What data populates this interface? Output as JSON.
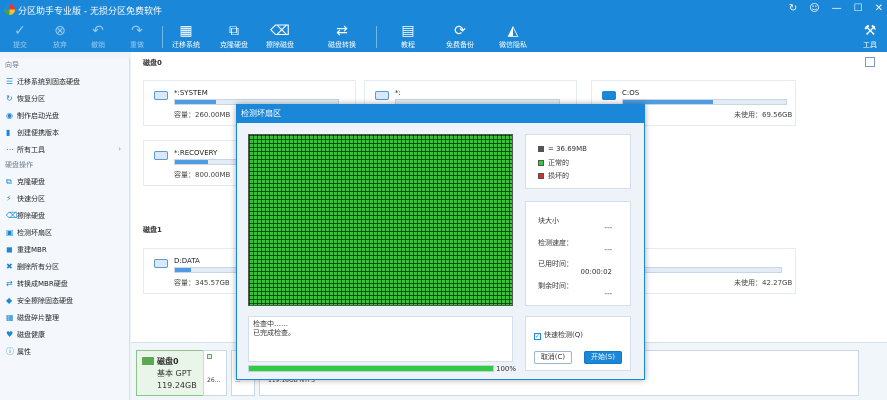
{
  "app": {
    "title": "分区助手专业版 - 无损分区免费软件",
    "window_buttons": [
      "↻",
      "☺",
      "—",
      "☐",
      "✕"
    ]
  },
  "toolbar": {
    "left": [
      {
        "label": "提交",
        "icon": "check-icon",
        "glyph": "✓"
      },
      {
        "label": "放弃",
        "icon": "cancel-icon",
        "glyph": "⊗"
      },
      {
        "label": "撤销",
        "icon": "undo-icon",
        "glyph": "↶"
      },
      {
        "label": "重做",
        "icon": "redo-icon",
        "glyph": "↷"
      }
    ],
    "middle": [
      {
        "label": "迁移系统",
        "icon": "migrate-os-icon",
        "glyph": "▦"
      },
      {
        "label": "克隆硬盘",
        "icon": "clone-disk-icon",
        "glyph": "⧉"
      },
      {
        "label": "擦除磁盘",
        "icon": "wipe-disk-icon",
        "glyph": "⌫"
      },
      {
        "label": "磁盘转换",
        "icon": "convert-disk-icon",
        "glyph": "⇄"
      },
      {
        "label": "教程",
        "icon": "tutorial-icon",
        "glyph": "▤"
      },
      {
        "label": "免费备份",
        "icon": "backup-icon",
        "glyph": "⟳"
      },
      {
        "label": "微信隐私",
        "icon": "wechat-privacy-icon",
        "glyph": "◭"
      }
    ],
    "right": {
      "label": "工具",
      "icon": "tools-icon",
      "glyph": "⚒"
    }
  },
  "sidebar": {
    "wizard_heading": "向导",
    "wizard_items": [
      {
        "label": "迁移系统到固态硬盘",
        "icon": "☰"
      },
      {
        "label": "恢复分区",
        "icon": "↻"
      },
      {
        "label": "制作启动光盘",
        "icon": "◉"
      },
      {
        "label": "创建便携版本",
        "icon": "▮"
      },
      {
        "label": "所有工具",
        "icon": "⋯"
      }
    ],
    "disk_heading": "硬盘操作",
    "disk_items": [
      {
        "label": "克隆硬盘",
        "icon": "⧉"
      },
      {
        "label": "快速分区",
        "icon": "⚡"
      },
      {
        "label": "擦除硬盘",
        "icon": "⌫"
      },
      {
        "label": "检测坏扇区",
        "icon": "▣"
      },
      {
        "label": "重建MBR",
        "icon": "◼"
      },
      {
        "label": "删除所有分区",
        "icon": "✖"
      },
      {
        "label": "转换成MBR硬盘",
        "icon": "⇄"
      },
      {
        "label": "安全擦除固态硬盘",
        "icon": "◆"
      },
      {
        "label": "磁盘碎片整理",
        "icon": "▦"
      },
      {
        "label": "磁盘健康",
        "icon": "♥"
      },
      {
        "label": "属性",
        "icon": "ⓘ"
      }
    ]
  },
  "main": {
    "disk0_label": "磁盘0",
    "disk1_label": "磁盘1",
    "capacity_label": "容量：",
    "free_label": "未使用：",
    "partitions": [
      {
        "name": "*:SYSTEM",
        "capacity": "260.00MB",
        "free": "",
        "fill": 0.25
      },
      {
        "name": "*:",
        "capacity": "",
        "free": "",
        "fill": 0.0
      },
      {
        "name": "C:OS",
        "capacity": "",
        "free": "69.56GB",
        "fill": 0.55
      },
      {
        "name": "*:RECOVERY",
        "capacity": "800.00MB",
        "free": "",
        "fill": 0.2
      },
      {
        "name": "D:DATA",
        "capacity": "345.57GB",
        "free": "42.27GB",
        "fill": 0.1
      }
    ],
    "partial_free": [
      "GB",
      "GB"
    ]
  },
  "diskmap": {
    "disk_name": "磁盘0",
    "disk_type": "基本 GPT",
    "disk_size": "119.24GB",
    "cells": [
      {
        "text": "26..."
      },
      {
        "text": "..."
      },
      {
        "text": "119.18GB NTFS"
      }
    ]
  },
  "dialog": {
    "title": "检测坏扇区",
    "legend": [
      {
        "label": "= 36.69MB",
        "color": "#555555"
      },
      {
        "label": "正常的",
        "color": "#2ecc40"
      },
      {
        "label": "损坏的",
        "color": "#d32f2f"
      }
    ],
    "stats": [
      {
        "label": "块大小",
        "value": "---"
      },
      {
        "label": "检测速度：",
        "value": "---"
      },
      {
        "label": "已用时间：",
        "value": "00:00:02"
      },
      {
        "label": "剩余时间：",
        "value": "---"
      }
    ],
    "log_lines": [
      "检查中……",
      "已完成检查。"
    ],
    "progress": 1.0,
    "progress_text": "100%",
    "quick_check_label": "快速检测(Q)",
    "quick_check_checked": true,
    "cancel_label": "取消(C)",
    "start_label": "开始(S)"
  }
}
